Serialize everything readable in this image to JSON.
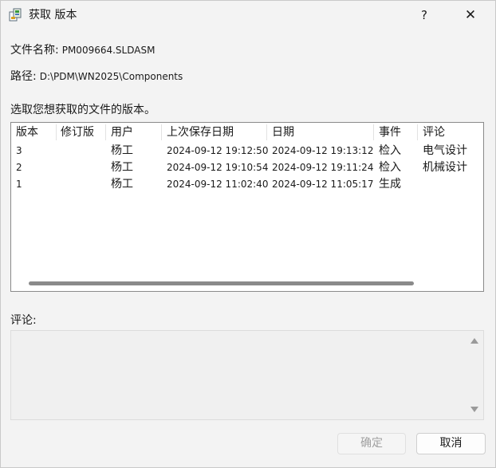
{
  "window": {
    "title": "获取 版本",
    "help_label": "?",
    "close_label": "✕"
  },
  "file": {
    "name_label": "文件名称:",
    "name_value": "PM009664.SLDASM",
    "path_label": "路径:",
    "path_value": "D:\\PDM\\WN2025\\Components"
  },
  "instruction": "选取您想获取的文件的版本。",
  "table": {
    "columns": [
      "版本",
      "修订版",
      "用户",
      "上次保存日期",
      "日期",
      "事件",
      "评论"
    ],
    "rows": [
      {
        "version": "3",
        "revision": "",
        "user": "杨工",
        "last_saved": "2024-09-12 19:12:50",
        "date": "2024-09-12 19:13:12",
        "event": "检入",
        "comment": "电气设计"
      },
      {
        "version": "2",
        "revision": "",
        "user": "杨工",
        "last_saved": "2024-09-12 19:10:54",
        "date": "2024-09-12 19:11:24",
        "event": "检入",
        "comment": "机械设计"
      },
      {
        "version": "1",
        "revision": "",
        "user": "杨工",
        "last_saved": "2024-09-12 11:02:40",
        "date": "2024-09-12 11:05:17",
        "event": "生成",
        "comment": ""
      }
    ]
  },
  "comment": {
    "label": "评论:",
    "value": ""
  },
  "buttons": {
    "ok_label": "确定",
    "cancel_label": "取消"
  },
  "colors": {
    "background": "#f3f3f3",
    "list_background": "#ffffff",
    "disabled_text": "#a0a0a0"
  }
}
